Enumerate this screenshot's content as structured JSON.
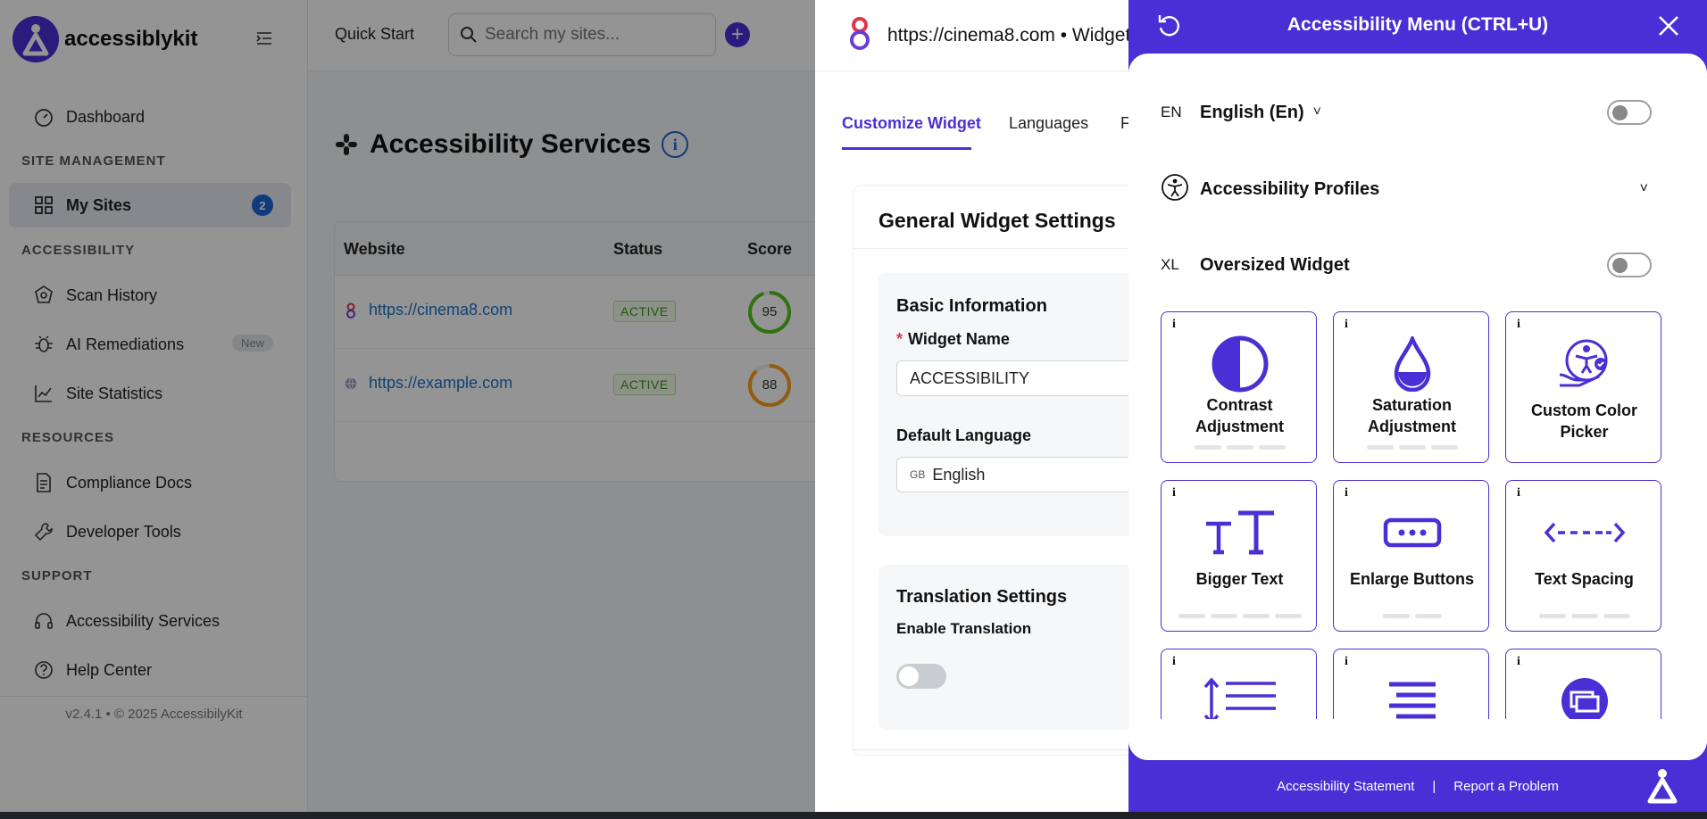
{
  "sidebar": {
    "brand": "accessiblykit",
    "dashboard": "Dashboard",
    "sections": {
      "site_management": "SITE MANAGEMENT",
      "accessibility": "ACCESSIBILITY",
      "resources": "RESOURCES",
      "support": "SUPPORT"
    },
    "items": {
      "my_sites": {
        "label": "My Sites",
        "count": "2"
      },
      "scan_history": "Scan History",
      "ai_remediations": {
        "label": "AI Remediations",
        "badge": "New"
      },
      "site_statistics": "Site Statistics",
      "compliance_docs": "Compliance Docs",
      "developer_tools": "Developer Tools",
      "accessibility_services": "Accessibility Services",
      "help_center": "Help Center"
    },
    "footer": "v2.4.1 • © 2025 AccessibilyKit"
  },
  "topbar": {
    "quick_start": "Quick Start",
    "search_placeholder": "Search my sites...",
    "add_label": "+"
  },
  "main": {
    "title": "Accessibility Services",
    "info": "i",
    "table": {
      "headers": [
        "Website",
        "Status",
        "Score"
      ],
      "rows": [
        {
          "site": "https://cinema8.com",
          "status": "ACTIVE",
          "score": "95",
          "score_value": 95,
          "ring_color": "#52c41a"
        },
        {
          "site": "https://example.com",
          "status": "ACTIVE",
          "score": "88",
          "score_value": 88,
          "ring_color": "#fa9f14"
        }
      ]
    }
  },
  "drawer": {
    "title": "https://cinema8.com • Widget",
    "tabs": [
      "Customize Widget",
      "Languages",
      "F"
    ],
    "card_title": "General Widget Settings",
    "basic": {
      "heading": "Basic Information",
      "required_mark": "*",
      "widget_name_label": "Widget Name",
      "widget_name_value": "ACCESSIBILITY",
      "default_language_label": "Default Language",
      "flag": "GB",
      "default_language_value": "English"
    },
    "translation": {
      "heading": "Translation Settings",
      "enable_label": "Enable Translation"
    }
  },
  "acc_menu": {
    "title": "Accessibility Menu (CTRL+U)",
    "language": {
      "prefix": "EN",
      "label": "English (En)",
      "chevron": "˅"
    },
    "profiles": {
      "label": "Accessibility Profiles",
      "chevron": "˅"
    },
    "oversized": {
      "prefix": "XL",
      "label": "Oversized Widget"
    },
    "tiles": [
      {
        "label": "Contrast Adjustment",
        "icon": "contrast-icon",
        "dots": 3
      },
      {
        "label": "Saturation Adjustment",
        "icon": "droplet-icon",
        "dots": 3
      },
      {
        "label": "Custom Color Picker",
        "icon": "color-picker-icon",
        "dots": 0
      },
      {
        "label": "Bigger Text",
        "icon": "text-size-icon",
        "dots": 4
      },
      {
        "label": "Enlarge Buttons",
        "icon": "buttons-icon",
        "dots": 2
      },
      {
        "label": "Text Spacing",
        "icon": "spacing-icon",
        "dots": 3
      },
      {
        "label": "",
        "icon": "line-height-icon",
        "dots": 0
      },
      {
        "label": "",
        "icon": "align-icon",
        "dots": 0
      },
      {
        "label": "",
        "icon": "screen-icon",
        "dots": 0
      }
    ],
    "tile_info": "i",
    "footer": {
      "statement": "Accessibility Statement",
      "separator": "|",
      "report": "Report a Problem"
    }
  },
  "colors": {
    "accent": "#4b2fd6",
    "link": "#1a73c9",
    "badge": "#1766d6"
  }
}
